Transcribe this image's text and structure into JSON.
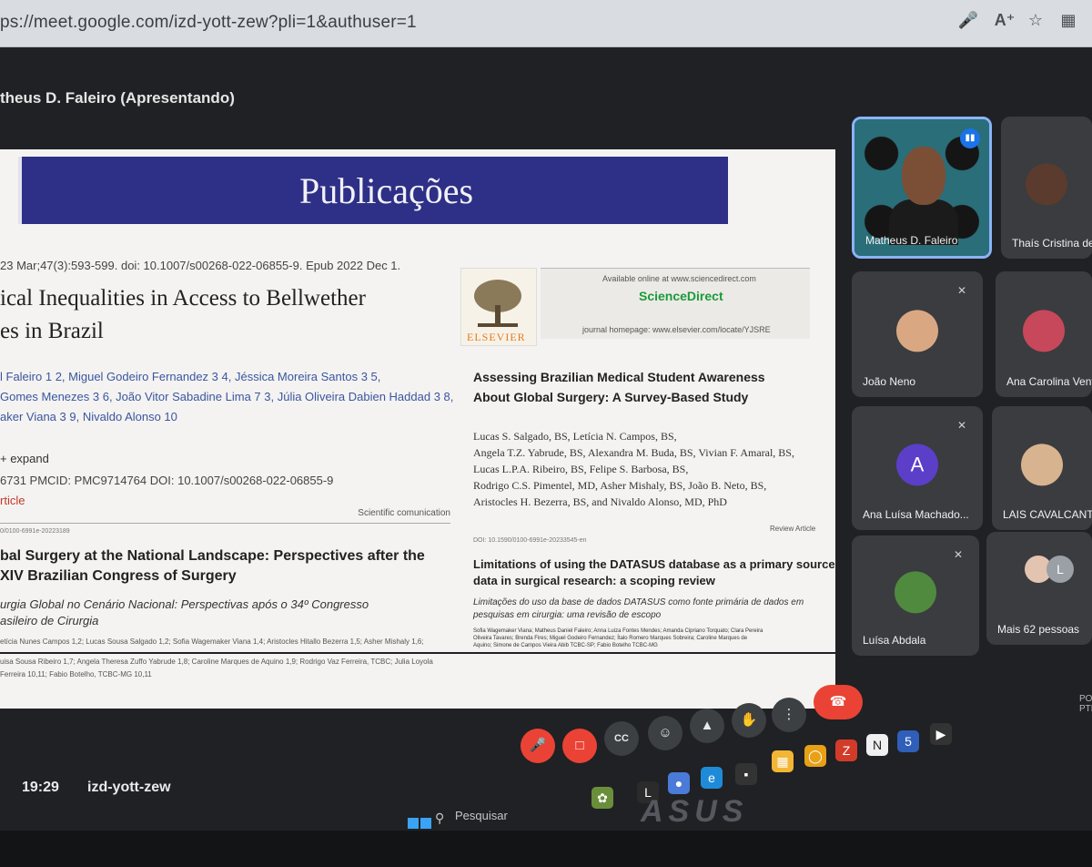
{
  "browser": {
    "url": "ps://meet.google.com/izd-yott-zew?pli=1&authuser=1",
    "icons": [
      "microphone-icon",
      "read-aloud-icon",
      "star-icon",
      "extensions-icon"
    ]
  },
  "meet": {
    "presenter_label": "theus D. Faleiro (Apresentando)",
    "time": "19:29",
    "meeting_code": "izd-yott-zew",
    "leave_icon": "hang-up-icon"
  },
  "slide": {
    "banner_title": "Publicações",
    "left_paper": {
      "journal_line": "23 Mar;47(3):593-599. doi: 10.1007/s00268-022-06855-9. Epub 2022 Dec 1.",
      "title_line1": "ical Inequalities in Access to Bellwether",
      "title_line2": "es in Brazil",
      "authors_line1": "l Faleiro 1 2, Miguel Godeiro Fernandez 3 4, Jéssica Moreira Santos 3 5,",
      "authors_line2": "Gomes Menezes 3 6, João Vitor Sabadine Lima 7 3, Júlia Oliveira Dabien Haddad 3 8,",
      "authors_line3": "aker Viana 3 9, Nivaldo Alonso 10",
      "expand": "+ expand",
      "ids": "6731  PMCID: PMC9714764  DOI: 10.1007/s00268-022-06855-9",
      "article": "rticle",
      "scientific_comm": "Scientific comunication",
      "doi_small": "0/0100-6991e-20223189",
      "sub_title1": "bal Surgery at the National Landscape: Perspectives after the",
      "sub_title2": "XIV Brazilian Congress of Surgery",
      "pt_title1": "urgia Global no Cenário Nacional: Perspectivas após o 34º Congresso",
      "pt_title2": "asileiro de Cirurgia",
      "authors_small1": "etícia Nunes Campos 1,2; Lucas Sousa Salgado 1,2; Sofia Wagemaker Viana 1,4; Aristocles Hitallo Bezerra 1,5; Asher Mishaly 1,6;",
      "authors_small2": "uisa Sousa Ribeiro 1,7; Angela Theresa Zuffo Yabrude 1,8; Caroline Marques de Aquino 1,9; Rodrigo Vaz Ferreira, TCBC; Julia Loyola",
      "authors_small3": "Ferreira 10,11; Fabio Botelho, TCBC-MG 10,11"
    },
    "right_paper": {
      "publisher": "ELSEVIER",
      "available_online": "Available online at www.sciencedirect.com",
      "brand": "ScienceDirect",
      "homepage": "journal homepage: www.elsevier.com/locate/YJSRE",
      "title_line1": "Assessing Brazilian Medical Student Awareness",
      "title_line2": "About Global Surgery: A Survey-Based Study",
      "authors": [
        "Lucas S. Salgado, BS, Letícia N. Campos, BS,",
        "Angela T.Z. Yabrude, BS, Alexandra M. Buda, BS, Vivian F. Amaral, BS,",
        "Lucas L.P.A. Ribeiro, BS, Felipe S. Barbosa, BS,",
        "Rodrigo C.S. Pimentel, MD, Asher Mishaly, BS, João B. Neto, BS,",
        "Aristocles H. Bezerra, BS, and Nivaldo Alonso, MD, PhD"
      ],
      "review_label": "Review Article",
      "doi": "DOI: 10.1590/0100-6991e-20233545-en",
      "lim_title1": "Limitations of using the DATASUS database as a primary source of",
      "lim_title2": "data in surgical research: a scoping review",
      "lim_pt1": "Limitações do uso da base de dados DATASUS como fonte primária de dados em",
      "lim_pt2": "pesquisas em cirurgia: uma revisão de escopo",
      "lim_authors1": "Sofia Wagemaker Viana; Matheus Daniel Faleiro; Anna Luiza Fontes Mendes; Amanda Cipriano Torquato; Clara Pereira",
      "lim_authors2": "Oliveira Tavares; Brenda Fires; Miguel Godeiro Fernandez; Ítalo Romero Marques Sobreira; Caroline Marques de",
      "lim_authors3": "Aquino; Simone de Campos Vieira Abib TCBC-SP; Fabio Botelho TCBC-MG"
    }
  },
  "participants": [
    {
      "name": "Matheus D. Faleiro",
      "state": "speaking"
    },
    {
      "name": "Thaís Cristina de",
      "state": "camera"
    },
    {
      "name": "João Neno",
      "state": "muted"
    },
    {
      "name": "Ana Carolina Vent",
      "state": "camera"
    },
    {
      "name": "Ana Luísa Machado...",
      "state": "muted",
      "initial": "A"
    },
    {
      "name": "LAIS CAVALCANTE",
      "state": "camera"
    },
    {
      "name": "Luísa Abdala",
      "state": "muted"
    },
    {
      "name": "Mais 62 pessoas",
      "state": "more",
      "initial": "L"
    }
  ],
  "taskbar": {
    "search_placeholder": "Pesquisar",
    "brand": "ASUS",
    "tray_text": "PO PTB"
  },
  "colors": {
    "banner": "#2e2f86",
    "meet_bg": "#1f2124",
    "active_border": "#8ab4f8",
    "leave": "#ea4335",
    "sciencedirect": "#1a9b3a"
  }
}
